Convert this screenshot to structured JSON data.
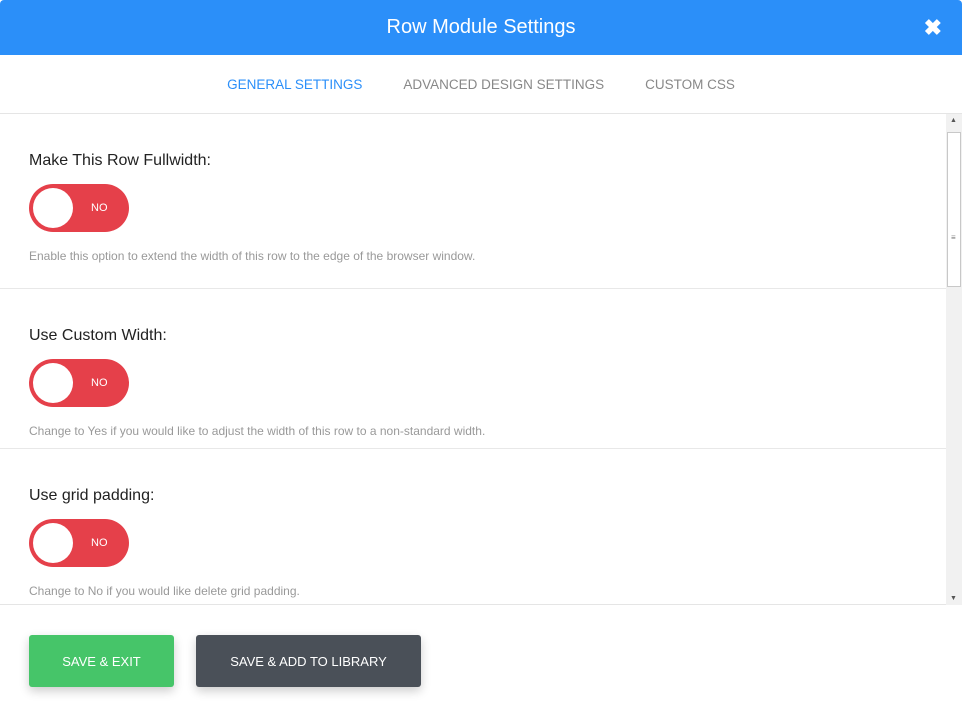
{
  "header": {
    "title": "Row Module Settings",
    "close_icon": "close-icon"
  },
  "tabs": [
    {
      "label": "GENERAL SETTINGS",
      "active": true
    },
    {
      "label": "ADVANCED DESIGN SETTINGS",
      "active": false
    },
    {
      "label": "CUSTOM CSS",
      "active": false
    }
  ],
  "settings": [
    {
      "label": "Make This Row Fullwidth:",
      "value": "NO",
      "description": "Enable this option to extend the width of this row to the edge of the browser window."
    },
    {
      "label": "Use Custom Width:",
      "value": "NO",
      "description": "Change to Yes if you would like to adjust the width of this row to a non-standard width."
    },
    {
      "label": "Use grid padding:",
      "value": "NO",
      "description": "Change to No if you would like delete grid padding."
    }
  ],
  "footer": {
    "save_exit": "SAVE & EXIT",
    "save_library": "SAVE & ADD TO LIBRARY"
  },
  "colors": {
    "accent": "#2b8ff9",
    "toggle_off": "#e5404a",
    "save": "#46c569",
    "library": "#4a5058"
  }
}
